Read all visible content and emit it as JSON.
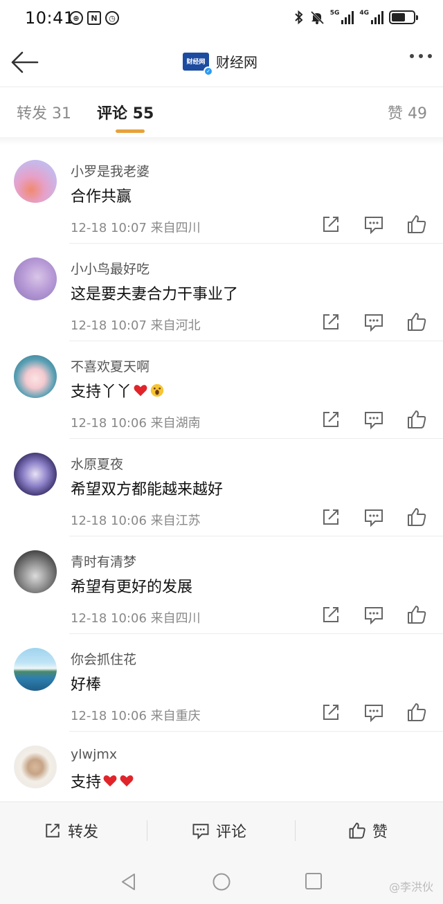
{
  "status_bar": {
    "time": "10:41",
    "icons": [
      "hd-icon",
      "nfc-icon",
      "alarm-icon",
      "bluetooth-icon",
      "mute-icon",
      "signal-5g-icon",
      "signal-4g-icon",
      "battery-icon"
    ],
    "net1": "5G",
    "net2": "4G"
  },
  "nav": {
    "title": "财经网",
    "logo_text": "财经网"
  },
  "tabs": [
    {
      "label": "转发 31",
      "active": false
    },
    {
      "label": "评论 55",
      "active": true
    },
    {
      "label": "赞 49",
      "active": false
    }
  ],
  "accent_color": "#e6a23c",
  "comments": [
    {
      "user": "小罗是我老婆",
      "text": "合作共赢",
      "emoji": "",
      "meta": "12-18 10:07  来自四川"
    },
    {
      "user": "小小鸟最好吃",
      "text": "这是要夫妻合力干事业了",
      "emoji": "",
      "meta": "12-18 10:07  来自河北"
    },
    {
      "user": "不喜欢夏天啊",
      "text": "支持丫丫",
      "emoji": "heart-icon, scream-emoji-icon",
      "meta": "12-18 10:06  来自湖南"
    },
    {
      "user": "水原夏夜",
      "text": "希望双方都能越来越好",
      "emoji": "",
      "meta": "12-18 10:06  来自江苏"
    },
    {
      "user": "青时有清梦",
      "text": "希望有更好的发展",
      "emoji": "",
      "meta": "12-18 10:06  来自四川"
    },
    {
      "user": "你会抓住花",
      "text": "好棒",
      "emoji": "",
      "meta": "12-18 10:06  来自重庆"
    },
    {
      "user": "ylwjmx",
      "text": "支持",
      "emoji": "heart-icon, heart-icon",
      "meta": ""
    }
  ],
  "bottom_bar": {
    "repost": "转发",
    "comment": "评论",
    "like": "赞"
  },
  "watermark": "@李洪伙"
}
